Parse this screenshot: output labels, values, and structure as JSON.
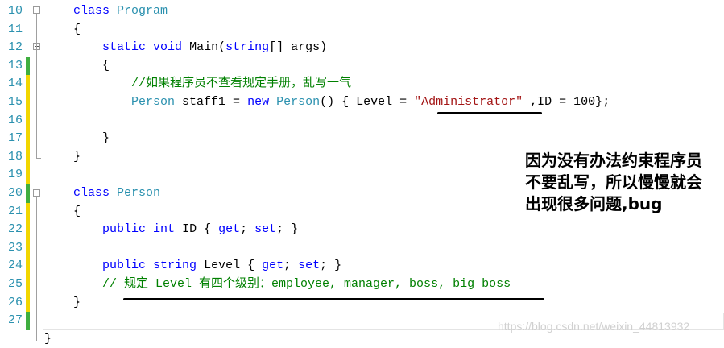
{
  "editor": {
    "lines": [
      {
        "num": "10",
        "tokens": [
          [
            "",
            "    "
          ],
          [
            "kw",
            "class"
          ],
          [
            "",
            " "
          ],
          [
            "ty",
            "Program"
          ]
        ]
      },
      {
        "num": "11",
        "tokens": [
          [
            "",
            "    {"
          ]
        ]
      },
      {
        "num": "12",
        "tokens": [
          [
            "",
            "        "
          ],
          [
            "kw",
            "static"
          ],
          [
            "",
            " "
          ],
          [
            "kw",
            "void"
          ],
          [
            "",
            " Main("
          ],
          [
            "kw",
            "string"
          ],
          [
            "",
            "[] args)"
          ]
        ]
      },
      {
        "num": "13",
        "tokens": [
          [
            "",
            "        {"
          ]
        ]
      },
      {
        "num": "14",
        "tokens": [
          [
            "",
            "            "
          ],
          [
            "cm",
            "//如果程序员不查看规定手册，乱写一气"
          ]
        ]
      },
      {
        "num": "15",
        "tokens": [
          [
            "",
            "            "
          ],
          [
            "ty",
            "Person"
          ],
          [
            "",
            " staff1 = "
          ],
          [
            "kw",
            "new"
          ],
          [
            "",
            " "
          ],
          [
            "ty",
            "Person"
          ],
          [
            "",
            "() { Level = "
          ],
          [
            "str",
            "\"Administrator\""
          ],
          [
            "",
            " ,ID = 100};"
          ]
        ]
      },
      {
        "num": "16",
        "tokens": [
          [
            "",
            ""
          ]
        ]
      },
      {
        "num": "17",
        "tokens": [
          [
            "",
            "        }"
          ]
        ]
      },
      {
        "num": "18",
        "tokens": [
          [
            "",
            "    }"
          ]
        ]
      },
      {
        "num": "19",
        "tokens": [
          [
            "",
            ""
          ]
        ]
      },
      {
        "num": "20",
        "tokens": [
          [
            "",
            "    "
          ],
          [
            "kw",
            "class"
          ],
          [
            "",
            " "
          ],
          [
            "ty",
            "Person"
          ]
        ]
      },
      {
        "num": "21",
        "tokens": [
          [
            "",
            "    {"
          ]
        ]
      },
      {
        "num": "22",
        "tokens": [
          [
            "",
            "        "
          ],
          [
            "kw",
            "public"
          ],
          [
            "",
            " "
          ],
          [
            "kw",
            "int"
          ],
          [
            "",
            " ID { "
          ],
          [
            "kw",
            "get"
          ],
          [
            "",
            "; "
          ],
          [
            "kw",
            "set"
          ],
          [
            "",
            "; }"
          ]
        ]
      },
      {
        "num": "23",
        "tokens": [
          [
            "",
            ""
          ]
        ]
      },
      {
        "num": "24",
        "tokens": [
          [
            "",
            "        "
          ],
          [
            "kw",
            "public"
          ],
          [
            "",
            " "
          ],
          [
            "kw",
            "string"
          ],
          [
            "",
            " Level { "
          ],
          [
            "kw",
            "get"
          ],
          [
            "",
            "; "
          ],
          [
            "kw",
            "set"
          ],
          [
            "",
            "; }"
          ]
        ]
      },
      {
        "num": "25",
        "tokens": [
          [
            "",
            "        "
          ],
          [
            "cm",
            "// 规定 Level 有四个级别：employee, manager, boss, big boss"
          ]
        ]
      },
      {
        "num": "26",
        "tokens": [
          [
            "",
            "    }"
          ]
        ]
      },
      {
        "num": "27",
        "tokens": [
          [
            "",
            ""
          ]
        ]
      },
      {
        "num": "",
        "tokens": [
          [
            "",
            "}"
          ]
        ]
      }
    ],
    "change_bars": [
      "",
      "",
      "",
      "green",
      "yellow",
      "yellow",
      "yellow",
      "yellow",
      "yellow",
      "yellow",
      "green",
      "yellow",
      "yellow",
      "yellow",
      "yellow",
      "yellow",
      "yellow",
      "green",
      ""
    ]
  },
  "annotation": {
    "note": "因为没有办法约束程序员不要乱写，所以慢慢就会出现很多问题,bug"
  },
  "watermark": "https://blog.csdn.net/weixin_44813932",
  "colors": {
    "keyword": "#0000ff",
    "type": "#2b91af",
    "comment": "#008000",
    "string": "#a31515",
    "line_number": "#2b91af",
    "change_modified": "#f2d600",
    "change_saved": "#3fae3f"
  }
}
